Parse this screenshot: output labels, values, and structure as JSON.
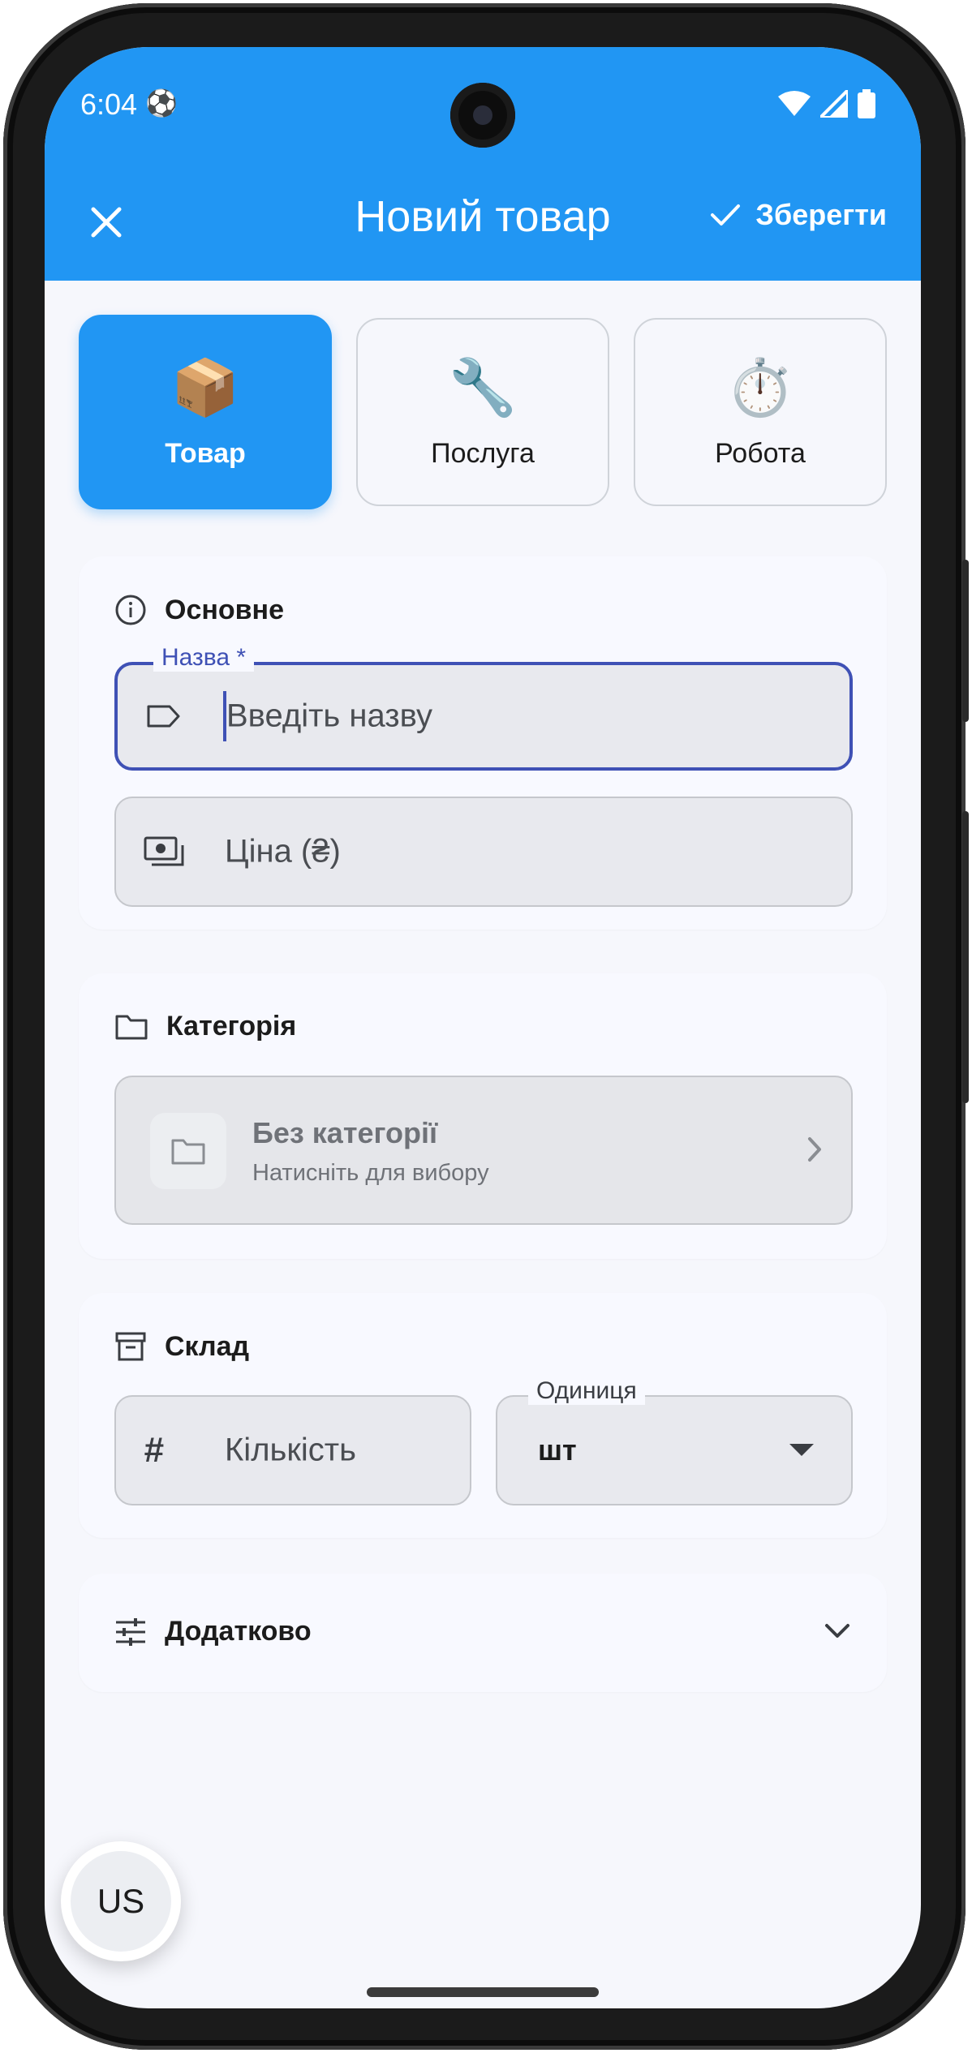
{
  "status_bar": {
    "time": "6:04",
    "notification_icon": "soccer-ball-icon"
  },
  "app_bar": {
    "title": "Новий товар",
    "close_icon": "close-icon",
    "save_label": "Зберегти",
    "background": "#2196f3"
  },
  "types": [
    {
      "emoji": "📦",
      "label": "Товар",
      "selected": true
    },
    {
      "emoji": "🔧",
      "label": "Послуга",
      "selected": false
    },
    {
      "emoji": "⏱️",
      "label": "Робота",
      "selected": false
    }
  ],
  "basic": {
    "heading": "Основне",
    "name_label": "Назва *",
    "name_placeholder": "Введіть назву",
    "price_placeholder": "Ціна (₴)"
  },
  "category": {
    "heading": "Категорія",
    "value": "Без категорії",
    "hint": "Натисніть для вибору"
  },
  "stock": {
    "heading": "Склад",
    "quantity_placeholder": "Кількість",
    "unit_label": "Одиниця",
    "unit_value": "шт"
  },
  "extra": {
    "heading": "Додатково"
  },
  "fab": {
    "label": "US"
  },
  "colors": {
    "accent": "#2196f3",
    "focus": "#3f51b5"
  }
}
